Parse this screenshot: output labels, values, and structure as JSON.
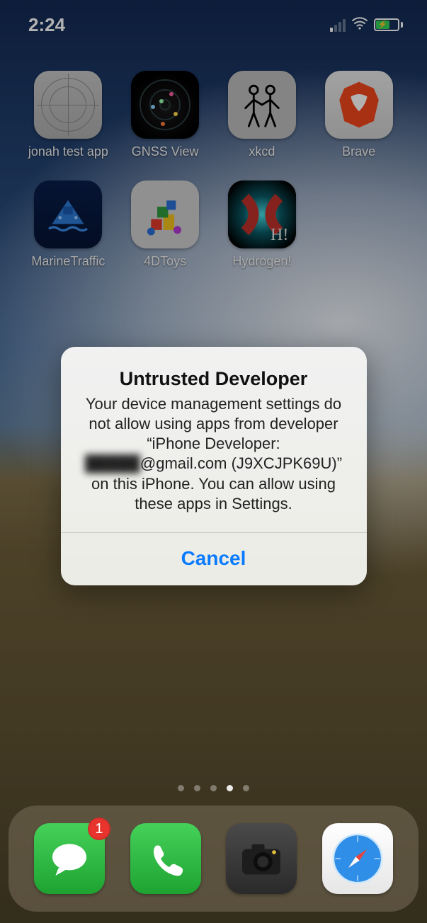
{
  "status": {
    "time": "2:24"
  },
  "apps": {
    "row1": [
      {
        "label": "jonah test app"
      },
      {
        "label": "GNSS View"
      },
      {
        "label": "xkcd"
      },
      {
        "label": "Brave"
      }
    ],
    "row2": [
      {
        "label": "MarineTraffic"
      },
      {
        "label": "4DToys"
      },
      {
        "label": "Hydrogen!"
      }
    ]
  },
  "alert": {
    "title": "Untrusted Developer",
    "body_line1": "Your device management settings do not allow using apps from developer “iPhone Developer:",
    "body_email_obscured": "█████",
    "body_email_visible": "@gmail.com (J9XCJPK69U)”",
    "body_line2": "on this iPhone. You can allow using these apps in Settings.",
    "cancel": "Cancel"
  },
  "dock": {
    "messages_badge": "1"
  },
  "page_indicator": {
    "count": 5,
    "active_index": 3
  }
}
